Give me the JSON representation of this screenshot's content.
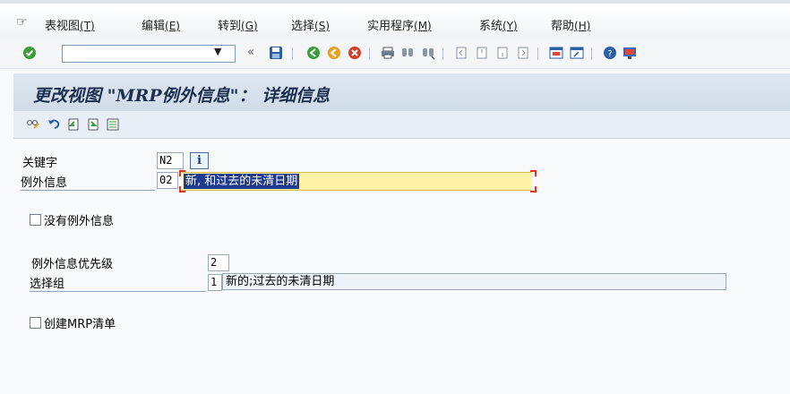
{
  "menubar": {
    "items": [
      {
        "label": "表视图",
        "acc": "(T)"
      },
      {
        "label": "编辑",
        "acc": "(E)"
      },
      {
        "label": "转到",
        "acc": "(G)"
      },
      {
        "label": "选择",
        "acc": "(S)"
      },
      {
        "label": "实用程序",
        "acc": "(M)"
      },
      {
        "label": "系统",
        "acc": "(Y)"
      },
      {
        "label": "帮助",
        "acc": "(H)"
      }
    ]
  },
  "toolbar": {
    "command_value": "",
    "icons": [
      "ok-check-icon",
      "save-icon",
      "back-icon",
      "exit-icon",
      "cancel-icon",
      "print-icon",
      "find-icon",
      "find-next-icon",
      "first-page-icon",
      "previous-page-icon",
      "next-page-icon",
      "last-page-icon",
      "new-session-icon",
      "shortcut-icon",
      "help-icon",
      "customize-layout-icon"
    ],
    "colors": {
      "ok": "#3a9c3a",
      "save": "#2b5fa8",
      "back": "#3a9c3a",
      "exit": "#e8a020",
      "cancel": "#d2402c",
      "help": "#2b5fa8"
    }
  },
  "page": {
    "title": "更改视图 \"MRP例外信息\"： 详细信息"
  },
  "form": {
    "key_label": "关键字",
    "key_value": "N2",
    "exception_label": "例外信息",
    "exception_code": "02",
    "exception_text": "新, 和过去的未清日期",
    "no_exception_label": "没有例外信息",
    "priority_label": "例外信息优先级",
    "priority_value": "2",
    "select_group_label": "选择组",
    "select_group_value": "1",
    "select_group_text": "新的;过去的未清日期",
    "create_mrp_list_label": "创建MRP清单",
    "info_button": "i"
  }
}
